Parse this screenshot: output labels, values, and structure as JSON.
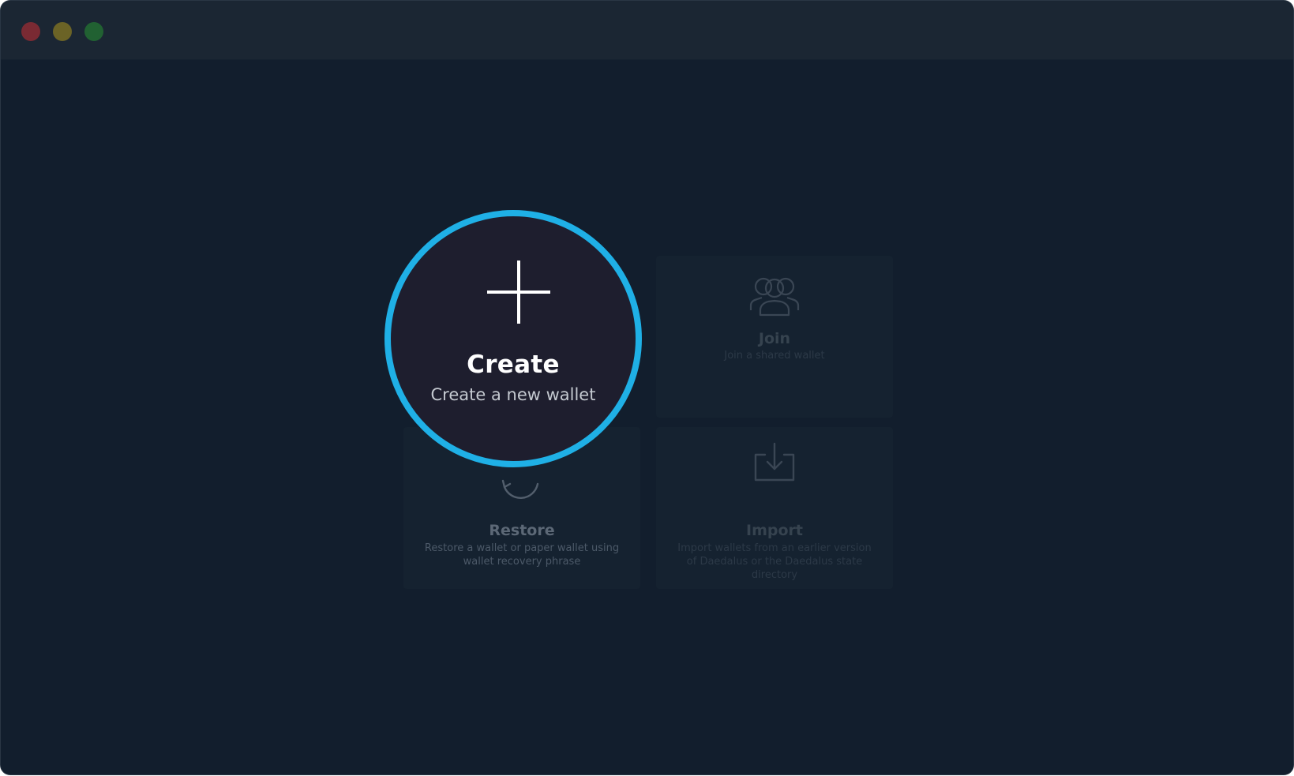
{
  "window": {
    "controls": [
      "close",
      "minimize",
      "zoom"
    ],
    "colors": {
      "background": "#121e2d",
      "titlebar": "#1b2633",
      "spotlight_ring": "#1fb0e6",
      "spotlight_fill": "#1e1e2e"
    }
  },
  "options": {
    "create": {
      "title": "Create",
      "description": "Create a new wallet",
      "icon": "plus-icon",
      "highlighted": true
    },
    "join": {
      "title": "Join",
      "description": "Join a shared wallet",
      "icon": "users-icon"
    },
    "restore": {
      "title": "Restore",
      "description": "Restore a wallet or paper wallet using wallet recovery phrase",
      "icon": "refresh-icon"
    },
    "import": {
      "title": "Import",
      "description": "Import wallets from an earlier version of Daedalus or the Daedalus state directory",
      "icon": "download-icon"
    }
  }
}
